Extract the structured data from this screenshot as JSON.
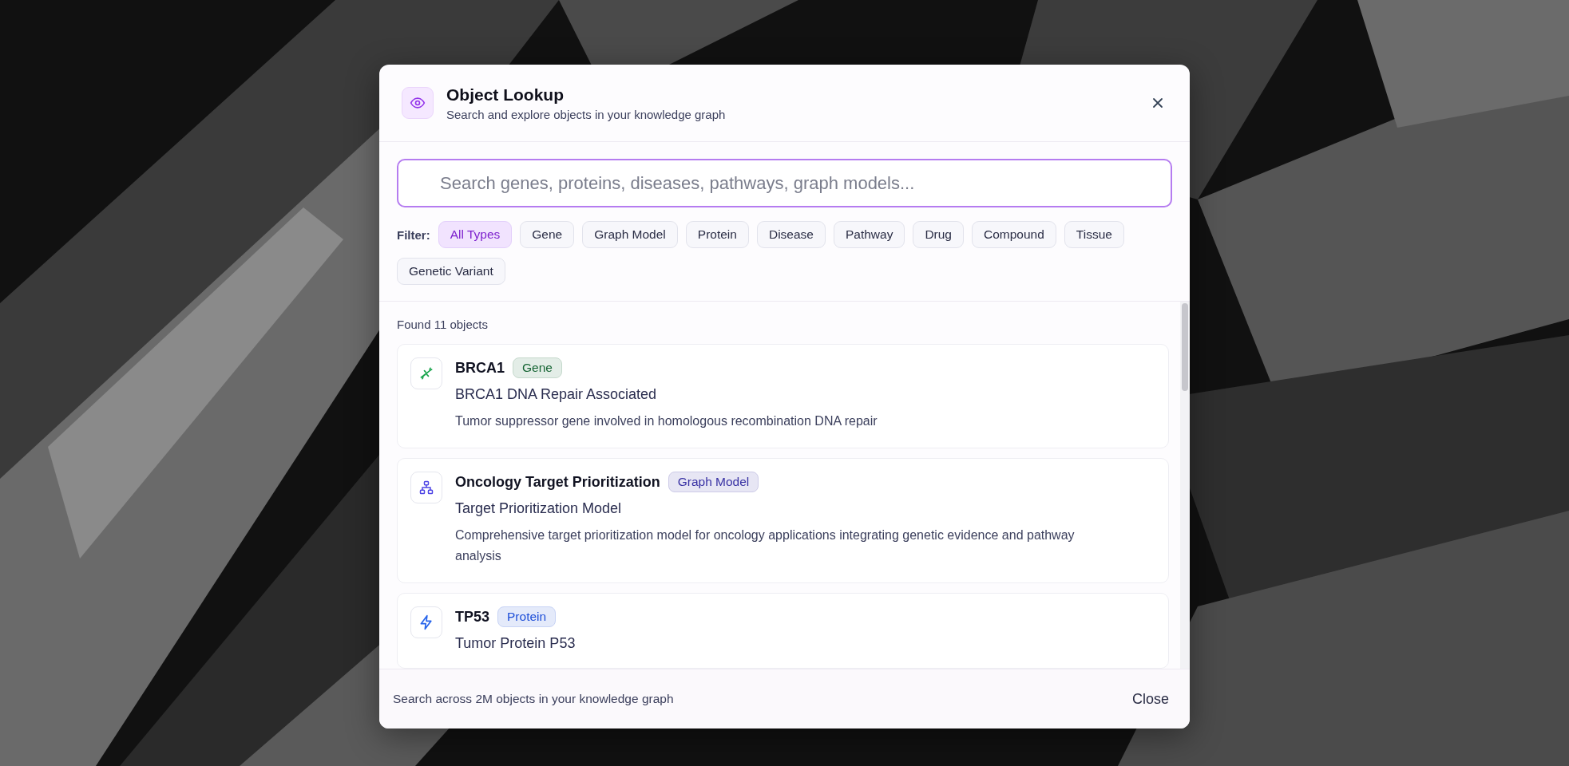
{
  "dialog": {
    "title": "Object Lookup",
    "subtitle": "Search and explore objects in your knowledge graph",
    "search": {
      "placeholder": "Search genes, proteins, diseases, pathways, graph models..."
    },
    "filter_label": "Filter:",
    "filters": [
      {
        "label": "All Types",
        "selected": true
      },
      {
        "label": "Gene",
        "selected": false
      },
      {
        "label": "Graph Model",
        "selected": false
      },
      {
        "label": "Protein",
        "selected": false
      },
      {
        "label": "Disease",
        "selected": false
      },
      {
        "label": "Pathway",
        "selected": false
      },
      {
        "label": "Drug",
        "selected": false
      },
      {
        "label": "Compound",
        "selected": false
      },
      {
        "label": "Tissue",
        "selected": false
      },
      {
        "label": "Genetic Variant",
        "selected": false
      }
    ],
    "result_count": "Found 11 objects",
    "results": [
      {
        "kind": "gene",
        "name": "BRCA1",
        "badge": {
          "label": "Gene",
          "color": "#166534"
        },
        "full_name": "BRCA1 DNA Repair Associated",
        "description": "Tumor suppressor gene involved in homologous recombination DNA repair"
      },
      {
        "kind": "graph_model",
        "name": "Oncology Target Prioritization",
        "badge": {
          "label": "Graph Model",
          "color": "#3730a3"
        },
        "full_name": "Target Prioritization Model",
        "description": "Comprehensive target prioritization model for oncology applications integrating genetic evidence and pathway analysis"
      },
      {
        "kind": "protein",
        "name": "TP53",
        "badge": {
          "label": "Protein",
          "color": "#1d4ed8"
        },
        "full_name": "Tumor Protein P53"
      }
    ],
    "footer_note": "Search across 2M objects in your knowledge graph",
    "close_label": "Close"
  }
}
